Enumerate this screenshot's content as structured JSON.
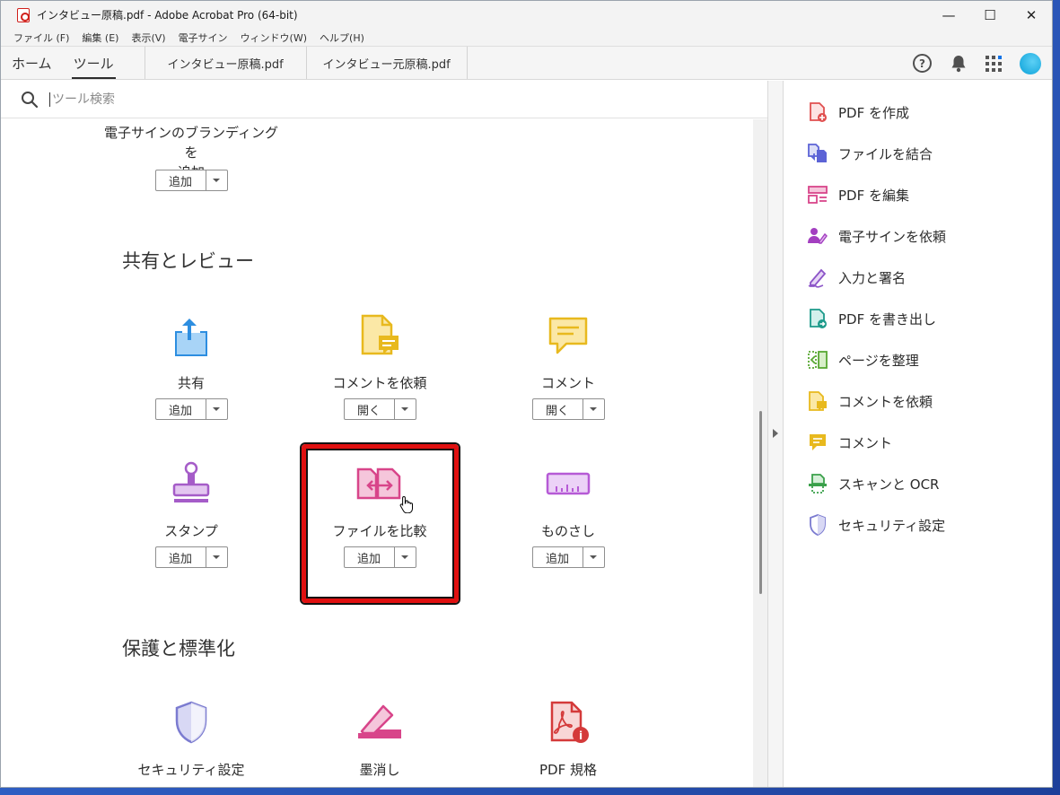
{
  "window": {
    "title": "インタビュー原稿.pdf - Adobe Acrobat Pro (64-bit)",
    "controls": {
      "minimize": "—",
      "maximize": "☐",
      "close": "✕"
    }
  },
  "menu": [
    "ファイル (F)",
    "編集 (E)",
    "表示(V)",
    "電子サイン",
    "ウィンドウ(W)",
    "ヘルプ(H)"
  ],
  "tabs": {
    "home": "ホーム",
    "tools": "ツール",
    "docs": [
      "インタビュー原稿.pdf",
      "インタビュー元原稿.pdf"
    ]
  },
  "header_icons": {
    "help": "?",
    "bell": "bell-icon",
    "apps": "apps-grid-icon",
    "profile": "avatar"
  },
  "search": {
    "placeholder": "ツール検索"
  },
  "top_tool": {
    "label": "電子サインのブランディングを追加",
    "label_line1": "電子サインのブランディングを",
    "label_line2": "追加",
    "button": "追加"
  },
  "sections": {
    "share_review": {
      "title": "共有とレビュー",
      "tools": [
        {
          "label": "共有",
          "button": "追加",
          "icon": "share-icon",
          "color": "#2d8ee0"
        },
        {
          "label": "コメントを依頼",
          "button": "開く",
          "icon": "request-comment-icon",
          "color": "#e8b91e"
        },
        {
          "label": "コメント",
          "button": "開く",
          "icon": "comment-icon",
          "color": "#e8b91e"
        },
        {
          "label": "スタンプ",
          "button": "追加",
          "icon": "stamp-icon",
          "color": "#a55cc8"
        },
        {
          "label": "ファイルを比較",
          "button": "追加",
          "icon": "compare-files-icon",
          "color": "#d8458a"
        },
        {
          "label": "ものさし",
          "button": "追加",
          "icon": "ruler-icon",
          "color": "#b65ad6"
        }
      ]
    },
    "protect_standardize": {
      "title": "保護と標準化",
      "tools": [
        {
          "label": "セキュリティ設定",
          "icon": "security-shield-icon",
          "color": "#7b7bd0"
        },
        {
          "label": "墨消し",
          "icon": "redact-icon",
          "color": "#d8458a"
        },
        {
          "label": "PDF 規格",
          "icon": "pdf-standards-icon",
          "color": "#d43a3a"
        }
      ]
    }
  },
  "right_panel": [
    {
      "label": "PDF を作成",
      "icon": "create-pdf-icon",
      "color": "#e04f4f"
    },
    {
      "label": "ファイルを結合",
      "icon": "combine-files-icon",
      "color": "#5c63d6"
    },
    {
      "label": "PDF を編集",
      "icon": "edit-pdf-icon",
      "color": "#d8458a"
    },
    {
      "label": "電子サインを依頼",
      "icon": "request-esign-icon",
      "color": "#a33fc0"
    },
    {
      "label": "入力と署名",
      "icon": "fill-sign-icon",
      "color": "#8c55c8"
    },
    {
      "label": "PDF を書き出し",
      "icon": "export-pdf-icon",
      "color": "#1c9a8a"
    },
    {
      "label": "ページを整理",
      "icon": "organize-pages-icon",
      "color": "#58a832"
    },
    {
      "label": "コメントを依頼",
      "icon": "request-comment-icon",
      "color": "#e8b91e"
    },
    {
      "label": "コメント",
      "icon": "comment-icon",
      "color": "#e8b91e"
    },
    {
      "label": "スキャンと OCR",
      "icon": "scan-ocr-icon",
      "color": "#3aa04a"
    },
    {
      "label": "セキュリティ設定",
      "icon": "security-shield-icon",
      "color": "#7b7bd0"
    }
  ]
}
